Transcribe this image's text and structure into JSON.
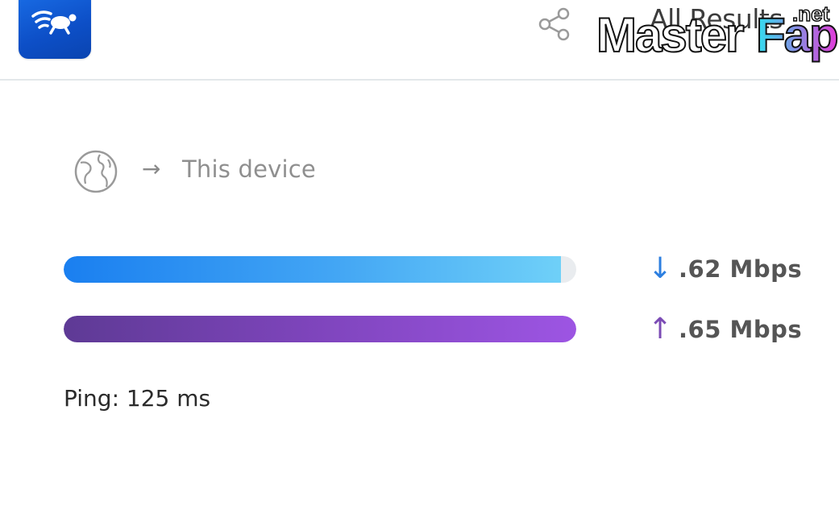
{
  "header": {
    "all_results_label": "All Results",
    "watermark_main": "MasterFap",
    "watermark_suffix": ".net"
  },
  "route": {
    "arrow": "→",
    "destination_label": "This device"
  },
  "download": {
    "arrow": "↓",
    "value": ".62 Mbps",
    "fill_fraction": 0.97,
    "color": "#1a7ff0"
  },
  "upload": {
    "arrow": "↑",
    "value": ".65 Mbps",
    "fill_fraction": 1.0,
    "color": "#9d55e3"
  },
  "ping": {
    "text": "Ping: 125 ms"
  },
  "icons": {
    "logo": "turtle-wifi-icon",
    "share": "share-icon",
    "globe": "globe-icon"
  }
}
